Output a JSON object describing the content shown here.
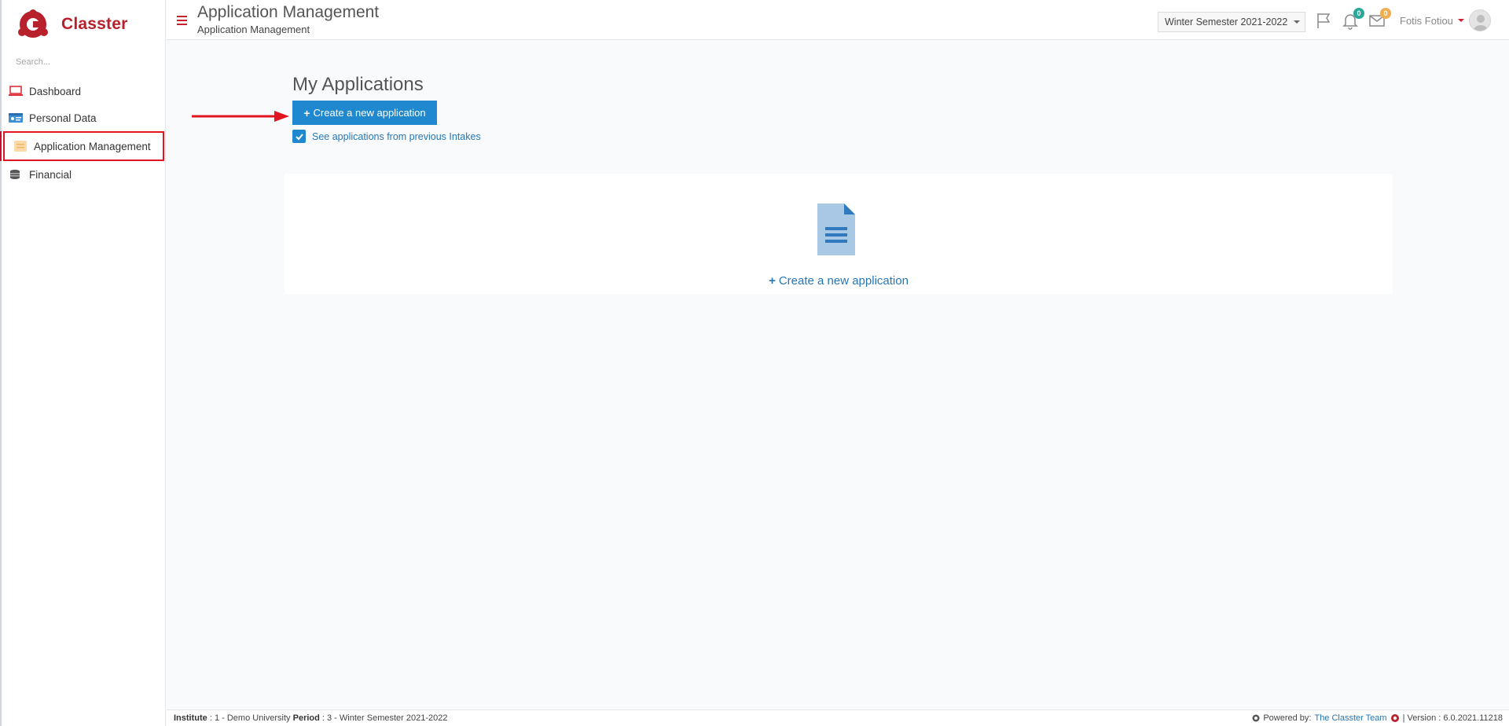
{
  "app": {
    "brand": "Classter"
  },
  "sidebar": {
    "search_placeholder": "Search...",
    "items": [
      {
        "label": "Dashboard",
        "icon": "laptop-icon"
      },
      {
        "label": "Personal Data",
        "icon": "id-card-icon"
      },
      {
        "label": "Application Management",
        "icon": "folder-icon",
        "active": true
      },
      {
        "label": "Financial",
        "icon": "coins-icon"
      }
    ]
  },
  "header": {
    "title": "Application Management",
    "subtitle": "Application Management",
    "semester": "Winter Semester 2021-2022",
    "notifications_count": "0",
    "messages_count": "0",
    "user_name": "Fotis Fotiou"
  },
  "main": {
    "section_title": "My Applications",
    "create_button": "Create a new application",
    "see_previous_label": "See applications from previous Intakes",
    "see_previous_checked": true,
    "empty_link": "Create a new application"
  },
  "footer": {
    "institute_label": "Institute",
    "institute_value": ": 1 - Demo University",
    "period_label": "Period",
    "period_value": ": 3 - Winter Semester 2021-2022",
    "powered_by": "Powered by:",
    "team_link": "The Classter Team",
    "version": "| Version : 6.0.2021.11218"
  },
  "colors": {
    "brand_red": "#b8202c",
    "primary_blue": "#1f88cf",
    "link_blue": "#2676b6",
    "highlight_red": "#e0151f"
  }
}
